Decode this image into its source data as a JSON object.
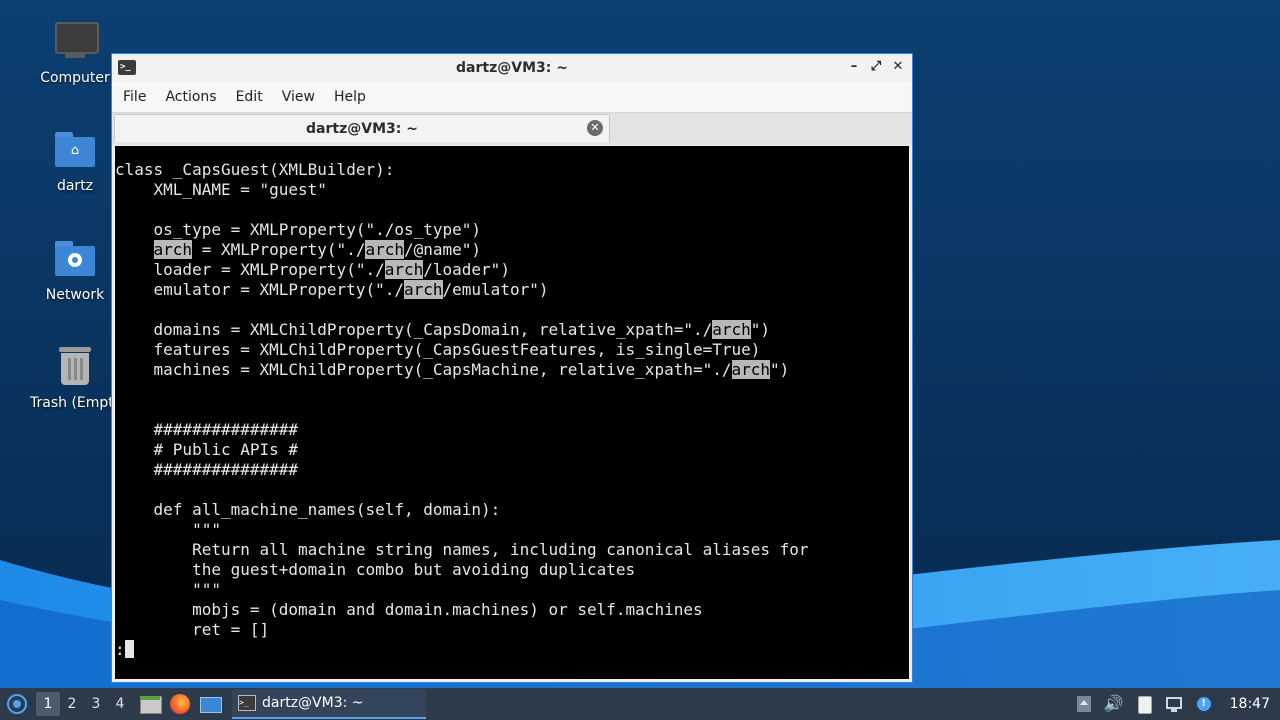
{
  "desktop": {
    "icons": [
      {
        "label": "Computer",
        "icon": "computer-icon"
      },
      {
        "label": "dartz",
        "icon": "home-folder-icon"
      },
      {
        "label": "Network",
        "icon": "network-folder-icon"
      },
      {
        "label": "Trash (Empty)",
        "icon": "trash-icon"
      }
    ]
  },
  "window": {
    "title": "dartz@VM3: ~",
    "menu": [
      "File",
      "Actions",
      "Edit",
      "View",
      "Help"
    ],
    "tab_title": "dartz@VM3: ~"
  },
  "terminal": {
    "lines": [
      "class _CapsGuest(XMLBuilder):",
      "    XML_NAME = \"guest\"",
      "",
      "    os_type = XMLProperty(\"./os_type\")",
      "    arch = XMLProperty(\"./arch/@name\")",
      "    loader = XMLProperty(\"./arch/loader\")",
      "    emulator = XMLProperty(\"./arch/emulator\")",
      "",
      "    domains = XMLChildProperty(_CapsDomain, relative_xpath=\"./arch\")",
      "    features = XMLChildProperty(_CapsGuestFeatures, is_single=True)",
      "    machines = XMLChildProperty(_CapsMachine, relative_xpath=\"./arch\")",
      "",
      "",
      "    ###############",
      "    # Public APIs #",
      "    ###############",
      "",
      "    def all_machine_names(self, domain):",
      "        \"\"\"",
      "        Return all machine string names, including canonical aliases for",
      "        the guest+domain combo but avoiding duplicates",
      "        \"\"\"",
      "        mobjs = (domain and domain.machines) or self.machines",
      "        ret = []"
    ],
    "highlight_term": "arch",
    "prompt": ":"
  },
  "taskbar": {
    "workspaces": [
      "1",
      "2",
      "3",
      "4"
    ],
    "active_workspace": "1",
    "task_label": "dartz@VM3: ~",
    "clock": "18:47"
  }
}
